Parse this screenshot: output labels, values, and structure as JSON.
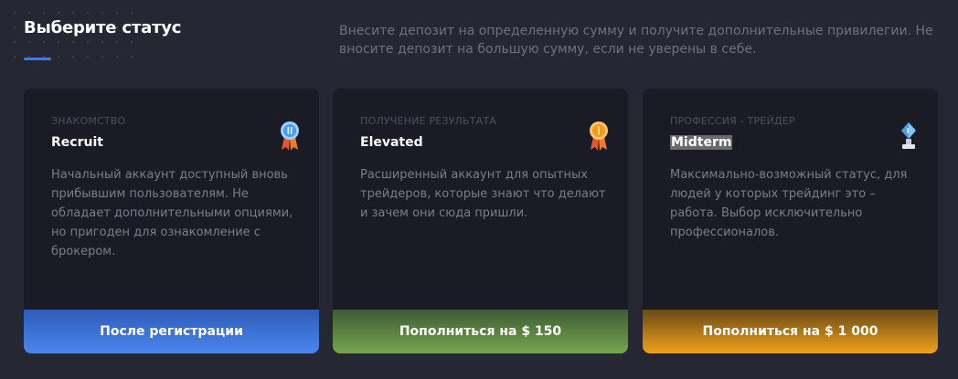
{
  "header": {
    "title": "Выберите статус",
    "description": "Внесите депозит на определенную сумму и получите дополнительные привилегии. Не вносите депозит на большую сумму, если не уверены в себе."
  },
  "cards": [
    {
      "category": "ЗНАКОМСТВО",
      "name": "Recruit",
      "text": "Начальный аккаунт доступный вновь прибывшим пользователям. Не обладает дополнительными опциями, но пригоден для ознакомление с брокером.",
      "button": "После регистрации",
      "icon": "blue-medal-icon",
      "accent": "#4a86ef"
    },
    {
      "category": "ПОЛУЧЕНИЕ РЕЗУЛЬТАТА",
      "name": "Elevated",
      "text": "Расширенный аккаунт для опытных трейдеров, которые знают что делают и зачем они сюда пришли.",
      "button": "Пополниться на $ 150",
      "icon": "orange-medal-icon",
      "accent": "#76a64d"
    },
    {
      "category": "ПРОФЕССИЯ - ТРЕЙДЕР",
      "name": "Midterm",
      "text": "Максимально-возможный статус, для людей у которых трейдинг это – работа. Выбор исключительно профессионалов.",
      "button": "Пополниться на $ 1 000",
      "icon": "diamond-trophy-icon",
      "accent": "#f0a11a"
    }
  ]
}
